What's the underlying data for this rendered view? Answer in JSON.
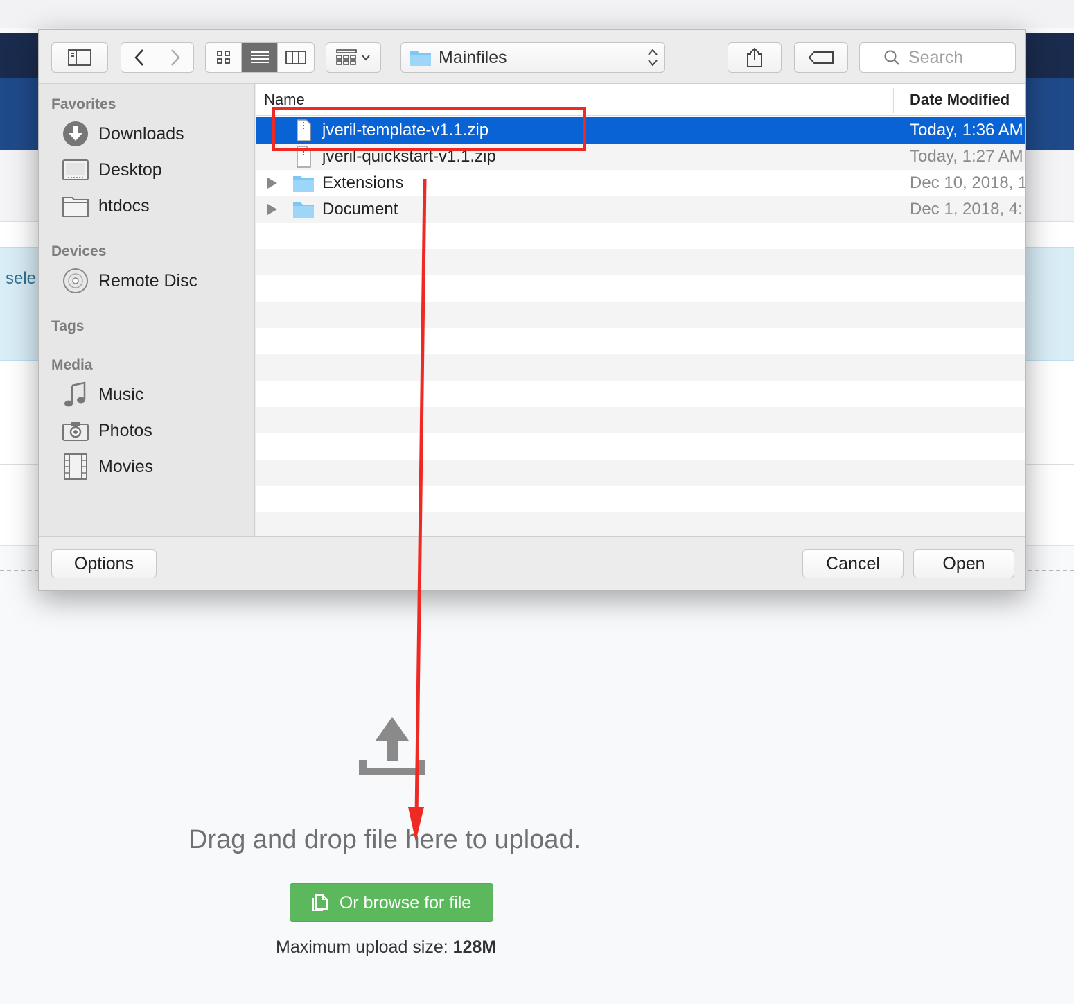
{
  "background": {
    "notice_text": "sele",
    "drop_text": "Drag and drop file here to upload.",
    "browse_label": "Or browse for file",
    "max_size_label": "Maximum upload size:",
    "max_size_value": "128M",
    "upload_icon": "upload-arrow-icon"
  },
  "dialog": {
    "toolbar": {
      "path": "Mainfiles",
      "search_placeholder": "Search",
      "icons": [
        "sidebar-toggle-icon",
        "back-icon",
        "forward-icon",
        "icon-view-icon",
        "list-view-icon",
        "column-view-icon",
        "group-icon",
        "share-icon",
        "tag-icon",
        "search-icon"
      ]
    },
    "sidebar": {
      "favorites_label": "Favorites",
      "favorites": [
        {
          "label": "Downloads",
          "icon": "downloads-icon"
        },
        {
          "label": "Desktop",
          "icon": "desktop-icon"
        },
        {
          "label": "htdocs",
          "icon": "folder-icon"
        }
      ],
      "devices_label": "Devices",
      "devices": [
        {
          "label": "Remote Disc",
          "icon": "disc-icon"
        }
      ],
      "tags_label": "Tags",
      "media_label": "Media",
      "media": [
        {
          "label": "Music",
          "icon": "music-icon"
        },
        {
          "label": "Photos",
          "icon": "camera-icon"
        },
        {
          "label": "Movies",
          "icon": "film-icon"
        }
      ]
    },
    "columns": {
      "name": "Name",
      "date": "Date Modified"
    },
    "files": [
      {
        "name": "jveril-template-v1.1.zip",
        "date": "Today, 1:36 AM",
        "type": "zip",
        "selected": true
      },
      {
        "name": "jveril-quickstart-v1.1.zip",
        "date": "Today, 1:27 AM",
        "type": "zip",
        "selected": false
      },
      {
        "name": "Extensions",
        "date": "Dec 10, 2018, 1",
        "type": "folder",
        "selected": false
      },
      {
        "name": "Document",
        "date": "Dec 1, 2018, 4:",
        "type": "folder",
        "selected": false
      }
    ],
    "footer": {
      "options_label": "Options",
      "cancel_label": "Cancel",
      "open_label": "Open"
    }
  },
  "colors": {
    "selection": "#0a63d5",
    "annotation": "#ef2a24",
    "browse_button": "#5cb85c",
    "navbar": "#1a2b4d"
  }
}
